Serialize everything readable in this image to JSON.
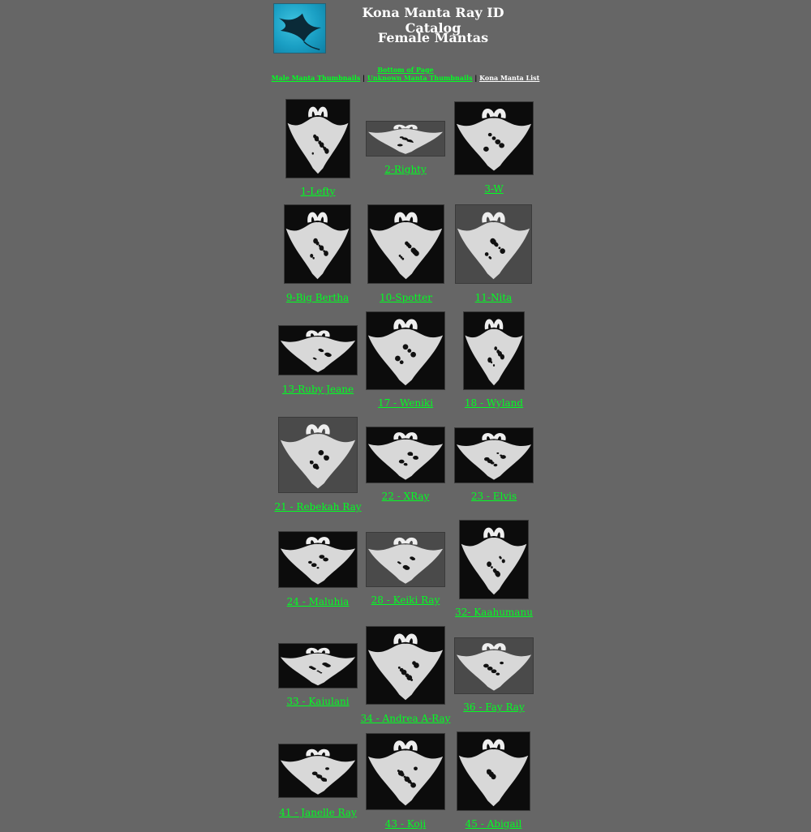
{
  "header": {
    "title": "Kona Manta Ray ID Catalog",
    "subtitle": "Female Mantas",
    "logo_icon": "manta-ray-logo-icon"
  },
  "nav": {
    "bottom_link": "Bottom of Page",
    "male_link": "Male Manta Thumbnails",
    "separator": "|",
    "unknown_link": "Unknown Manta Thumbnails",
    "list_link": "Kona Manta List"
  },
  "colors": {
    "background": "#666666",
    "link": "#00ff22",
    "title": "#ffffff"
  },
  "mantas": [
    {
      "label": "1-Lefty"
    },
    {
      "label": "2-Righty"
    },
    {
      "label": "3-W"
    },
    {
      "label": "9-Big Bertha"
    },
    {
      "label": "10-Spotter"
    },
    {
      "label": "11-Nita"
    },
    {
      "label": "13-Ruby Jeane"
    },
    {
      "label": "17 - Weniki"
    },
    {
      "label": "18 - Wyland"
    },
    {
      "label": "21 - Rebekah Ray"
    },
    {
      "label": "22 - XRay"
    },
    {
      "label": "23 - Elvis"
    },
    {
      "label": "24 - Maluhia"
    },
    {
      "label": "28 - Keiki Ray"
    },
    {
      "label": "32- Kaahumanu"
    },
    {
      "label": "33 - Kaiulani"
    },
    {
      "label": "34 - Andrea A-Ray"
    },
    {
      "label": "36 - Fay Ray"
    },
    {
      "label": "41 - Janelle Ray"
    },
    {
      "label": "43 - Koji"
    },
    {
      "label": "45 - Abigail"
    }
  ]
}
